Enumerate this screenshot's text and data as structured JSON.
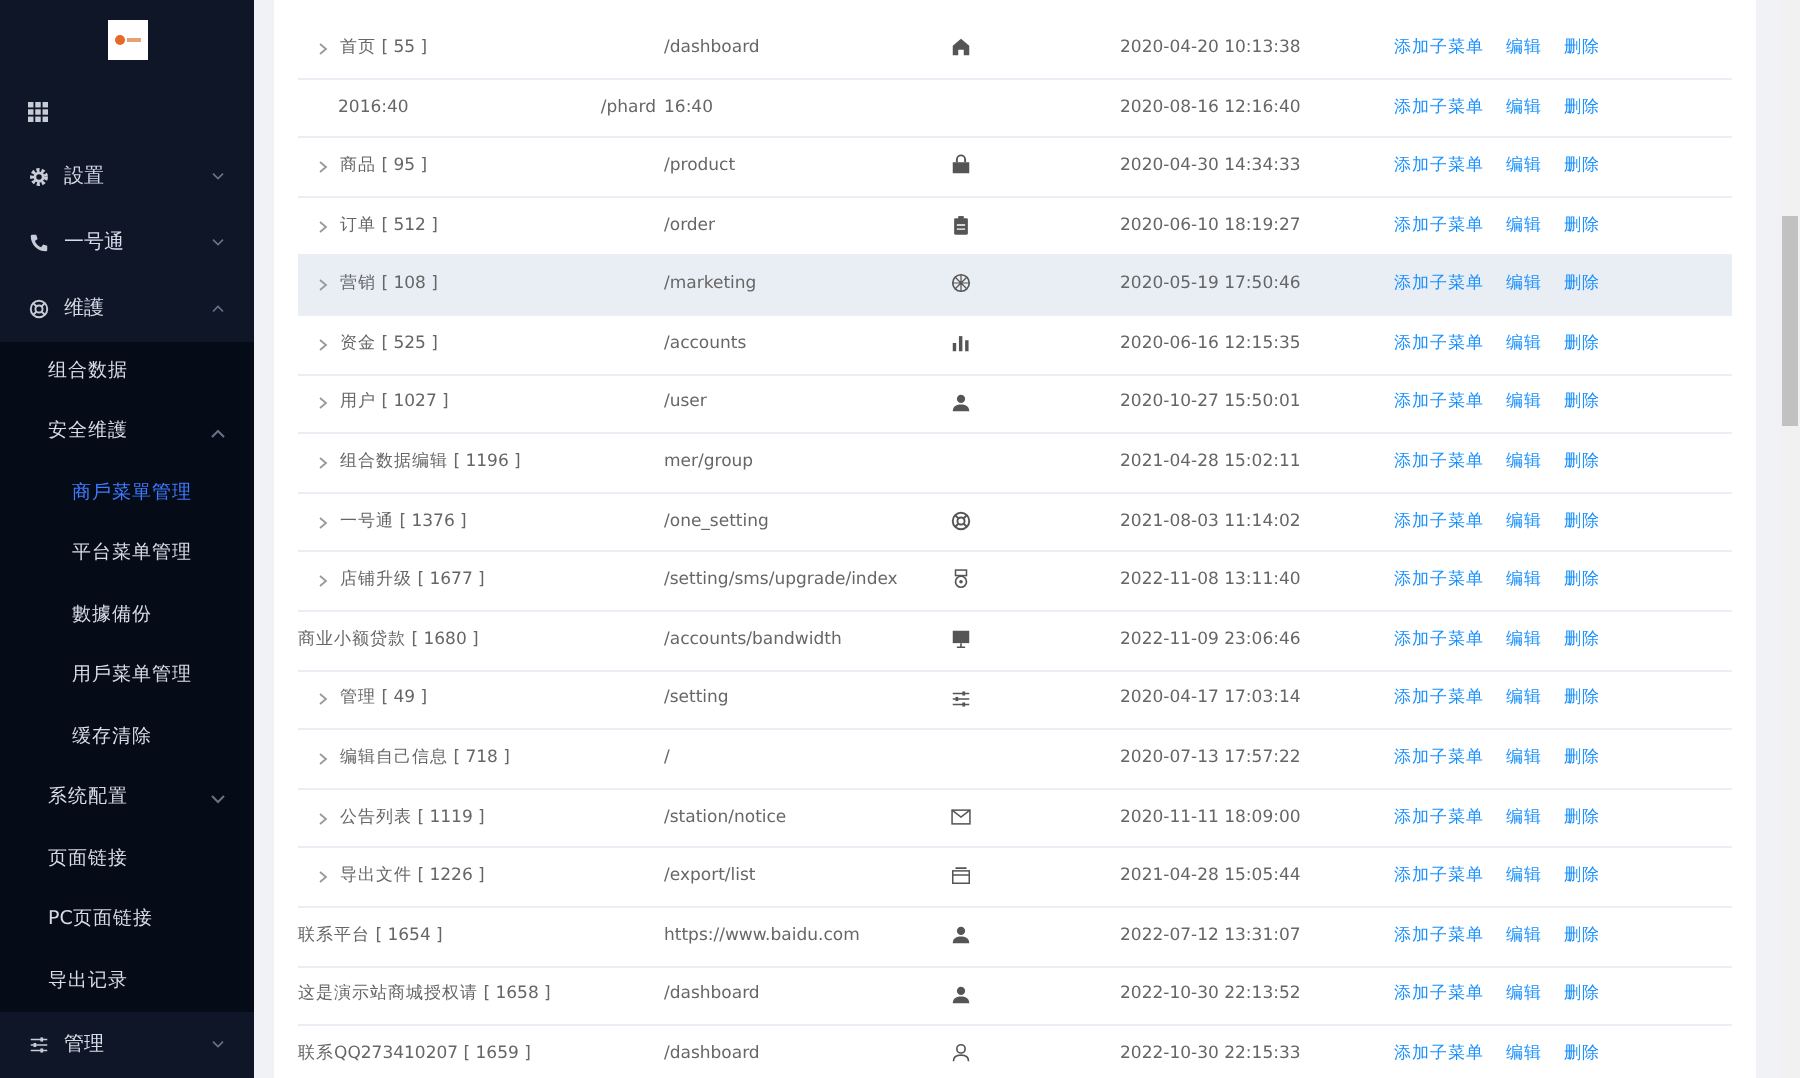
{
  "sidebar": {
    "items": [
      {
        "label": "設置",
        "expanded": false
      },
      {
        "label": "一号通",
        "expanded": false
      },
      {
        "label": "维護",
        "expanded": true,
        "children": [
          {
            "label": "组合数据",
            "selected": false
          },
          {
            "label": "安全维護",
            "selected": false,
            "expanded": true,
            "children": [
              {
                "label": "商戶菜單管理",
                "selected": true
              },
              {
                "label": "平台菜单管理",
                "selected": false
              },
              {
                "label": "數據備份",
                "selected": false
              },
              {
                "label": "用戶菜单管理",
                "selected": false
              },
              {
                "label": "缓存清除",
                "selected": false
              }
            ]
          },
          {
            "label": "系统配置",
            "selected": false,
            "expanded": false
          },
          {
            "label": "页面链接",
            "selected": false
          },
          {
            "label": "PC页面链接",
            "selected": false
          },
          {
            "label": "导出记录",
            "selected": false
          }
        ]
      },
      {
        "label": "管理",
        "expanded": false
      }
    ]
  },
  "table": {
    "rows": [
      {
        "name": "首页 [ 55 ]",
        "path": "/dashboard",
        "time": "2020-04-20 10:13:38",
        "expandable": true,
        "hovered": false,
        "actions": [
          "添加子菜单",
          "编辑",
          "删除"
        ]
      },
      {
        "name": "2016:40",
        "extra": "/phard",
        "path": "16:40",
        "time": "2020-08-16 12:16:40",
        "expandable": false,
        "hovered": false,
        "actions": [
          "添加子菜单",
          "编辑",
          "删除"
        ]
      },
      {
        "name": "商品 [ 95 ]",
        "path": "/product",
        "time": "2020-04-30 14:34:33",
        "expandable": true,
        "hovered": false,
        "actions": [
          "添加子菜单",
          "编辑",
          "删除"
        ]
      },
      {
        "name": "订单 [ 512 ]",
        "path": "/order",
        "time": "2020-06-10 18:19:27",
        "expandable": true,
        "hovered": false,
        "actions": [
          "添加子菜单",
          "编辑",
          "删除"
        ]
      },
      {
        "name": "营销 [ 108 ]",
        "path": "/marketing",
        "time": "2020-05-19 17:50:46",
        "expandable": true,
        "hovered": true,
        "actions": [
          "添加子菜单",
          "编辑",
          "删除"
        ]
      },
      {
        "name": "资金 [ 525 ]",
        "path": "/accounts",
        "time": "2020-06-16 12:15:35",
        "expandable": true,
        "hovered": false,
        "actions": [
          "添加子菜单",
          "编辑",
          "删除"
        ]
      },
      {
        "name": "用户 [ 1027 ]",
        "path": "/user",
        "time": "2020-10-27 15:50:01",
        "expandable": true,
        "hovered": false,
        "actions": [
          "添加子菜单",
          "编辑",
          "删除"
        ]
      },
      {
        "name": "组合数据编辑 [ 1196 ]",
        "path": "mer/group",
        "time": "2021-04-28 15:02:11",
        "expandable": true,
        "hovered": false,
        "actions": [
          "添加子菜单",
          "编辑",
          "删除"
        ]
      },
      {
        "name": "一号通 [ 1376 ]",
        "path": "/one_setting",
        "time": "2021-08-03 11:14:02",
        "expandable": true,
        "hovered": false,
        "actions": [
          "添加子菜单",
          "编辑",
          "删除"
        ]
      },
      {
        "name": "店铺升级 [ 1677 ]",
        "path": "/setting/sms/upgrade/index",
        "time": "2022-11-08 13:11:40",
        "expandable": true,
        "hovered": false,
        "actions": [
          "添加子菜单",
          "编辑",
          "删除"
        ]
      },
      {
        "name": "商业小额贷款 [ 1680 ]",
        "path": "/accounts/bandwidth",
        "time": "2022-11-09 23:06:46",
        "expandable": false,
        "hovered": false,
        "actions": [
          "添加子菜单",
          "编辑",
          "删除"
        ]
      },
      {
        "name": "管理 [ 49 ]",
        "path": "/setting",
        "time": "2020-04-17 17:03:14",
        "expandable": true,
        "hovered": false,
        "actions": [
          "添加子菜单",
          "编辑",
          "删除"
        ]
      },
      {
        "name": "编辑自己信息 [ 718 ]",
        "path": "/",
        "time": "2020-07-13 17:57:22",
        "expandable": true,
        "hovered": false,
        "actions": [
          "添加子菜单",
          "编辑",
          "删除"
        ]
      },
      {
        "name": "公告列表 [ 1119 ]",
        "path": "/station/notice",
        "time": "2020-11-11 18:09:00",
        "expandable": true,
        "hovered": false,
        "actions": [
          "添加子菜单",
          "编辑",
          "删除"
        ]
      },
      {
        "name": "导出文件 [ 1226 ]",
        "path": "/export/list",
        "time": "2021-04-28 15:05:44",
        "expandable": true,
        "hovered": false,
        "actions": [
          "添加子菜单",
          "编辑",
          "删除"
        ]
      },
      {
        "name": "联系平台 [ 1654 ]",
        "path": "https://www.baidu.com",
        "time": "2022-07-12 13:31:07",
        "expandable": false,
        "hovered": false,
        "actions": [
          "添加子菜单",
          "编辑",
          "删除"
        ]
      },
      {
        "name": "这是演示站商城授权请 [ 1658 ]",
        "path": "/dashboard",
        "time": "2022-10-30 22:13:52",
        "expandable": false,
        "hovered": false,
        "actions": [
          "添加子菜单",
          "编辑",
          "删除"
        ]
      },
      {
        "name": "联系QQ273410207 [ 1659 ]",
        "path": "/dashboard",
        "time": "2022-10-30 22:15:33",
        "expandable": false,
        "hovered": false,
        "actions": [
          "添加子菜单",
          "编辑",
          "删除"
        ]
      }
    ]
  }
}
